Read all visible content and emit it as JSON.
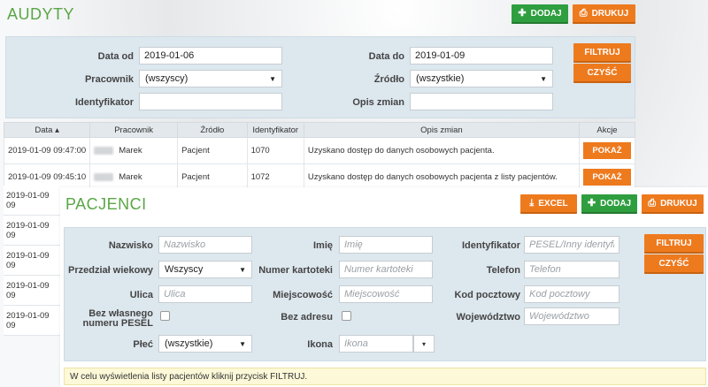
{
  "audyty": {
    "title": "AUDYTY",
    "buttons": {
      "add": "DODAJ",
      "print": "DRUKUJ",
      "filter": "FILTRUJ",
      "clear": "CZYŚĆ"
    },
    "filters": {
      "date_from_label": "Data od",
      "date_from_value": "2019-01-06",
      "date_to_label": "Data do",
      "date_to_value": "2019-01-09",
      "employee_label": "Pracownik",
      "employee_value": "(wszyscy)",
      "source_label": "Źródło",
      "source_value": "(wszystkie)",
      "identifier_label": "Identyfikator",
      "identifier_value": "",
      "changes_label": "Opis zmian",
      "changes_value": ""
    },
    "table": {
      "headers": [
        "Data",
        "Pracownik",
        "Źródło",
        "Identyfikator",
        "Opis zmian",
        "Akcje"
      ],
      "rows": [
        {
          "date": "2019-01-09 09:47:00",
          "employee": "Marek",
          "source": "Pacjent",
          "identifier": "1070",
          "description": "Uzyskano dostęp do danych osobowych pacjenta.",
          "action": "POKAŻ"
        },
        {
          "date": "2019-01-09 09:45:10",
          "employee": "Marek",
          "source": "Pacjent",
          "identifier": "1072",
          "description": "Uzyskano dostęp do danych osobowych pacjenta z listy pacjentów.",
          "action": "POKAŻ"
        }
      ],
      "hidden_dates": [
        "2019-01-09 09",
        "2019-01-09 09",
        "2019-01-09 09",
        "2019-01-09 09",
        "2019-01-09 09"
      ]
    }
  },
  "pacjenci": {
    "title": "PACJENCI",
    "buttons": {
      "excel": "EXCEL",
      "add": "DODAJ",
      "print": "DRUKUJ",
      "filter": "FILTRUJ",
      "clear": "CZYŚĆ"
    },
    "fields": {
      "surname_label": "Nazwisko",
      "surname_placeholder": "Nazwisko",
      "name_label": "Imię",
      "name_placeholder": "Imię",
      "identifier_label": "Identyfikator",
      "identifier_placeholder": "PESEL/Inny identyfikator",
      "age_label": "Przedział wiekowy",
      "age_value": "Wszyscy",
      "card_label": "Numer kartoteki",
      "card_placeholder": "Numer kartoteki",
      "phone_label": "Telefon",
      "phone_placeholder": "Telefon",
      "street_label": "Ulica",
      "street_placeholder": "Ulica",
      "city_label": "Miejscowość",
      "city_placeholder": "Miejscowość",
      "postal_label": "Kod pocztowy",
      "postal_placeholder": "Kod pocztowy",
      "no_pesel_label_1": "Bez własnego",
      "no_pesel_label_2": "numeru PESEL",
      "no_address_label": "Bez adresu",
      "voivodeship_label": "Województwo",
      "voivodeship_placeholder": "Województwo",
      "sex_label": "Płeć",
      "sex_value": "(wszystkie)",
      "icon_label": "Ikona",
      "icon_placeholder": "Ikona"
    },
    "hint": "W celu wyświetlenia listy pacjentów kliknij przycisk FILTRUJ."
  },
  "icons": {
    "add": "plus-icon",
    "print": "printer-icon",
    "excel": "download-icon",
    "sort": "sort-up-icon",
    "dropdown": "chevron-down-icon"
  },
  "colors": {
    "title_green": "#5aa646",
    "btn_green": "#2f9e3f",
    "btn_orange": "#ee7a1e",
    "panel": "#dde7ee",
    "hint_bg": "#fcf8d8"
  }
}
